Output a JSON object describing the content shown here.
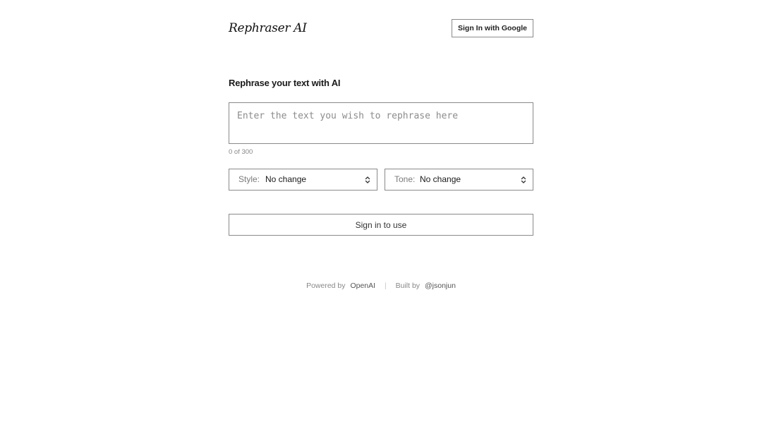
{
  "header": {
    "logo": "Rephraser AI",
    "signin_google_label": "Sign In with Google"
  },
  "main": {
    "heading": "Rephrase your text with AI",
    "textarea": {
      "value": "",
      "placeholder": "Enter the text you wish to rephrase here"
    },
    "counter": "0 of 300",
    "style_select": {
      "label": "Style:",
      "value": "No change"
    },
    "tone_select": {
      "label": "Tone:",
      "value": "No change"
    },
    "signin_use_label": "Sign in to use"
  },
  "footer": {
    "powered_prefix": "Powered by",
    "powered_link": "OpenAI",
    "separator": "|",
    "built_prefix": "Built by",
    "built_link": "@jsonjun"
  },
  "icons": {
    "select_chevrons": "chevron-up-down-icon"
  },
  "colors": {
    "background": "#ffffff",
    "border": "#8a8a8a",
    "text": "#111111",
    "muted": "#888888"
  }
}
